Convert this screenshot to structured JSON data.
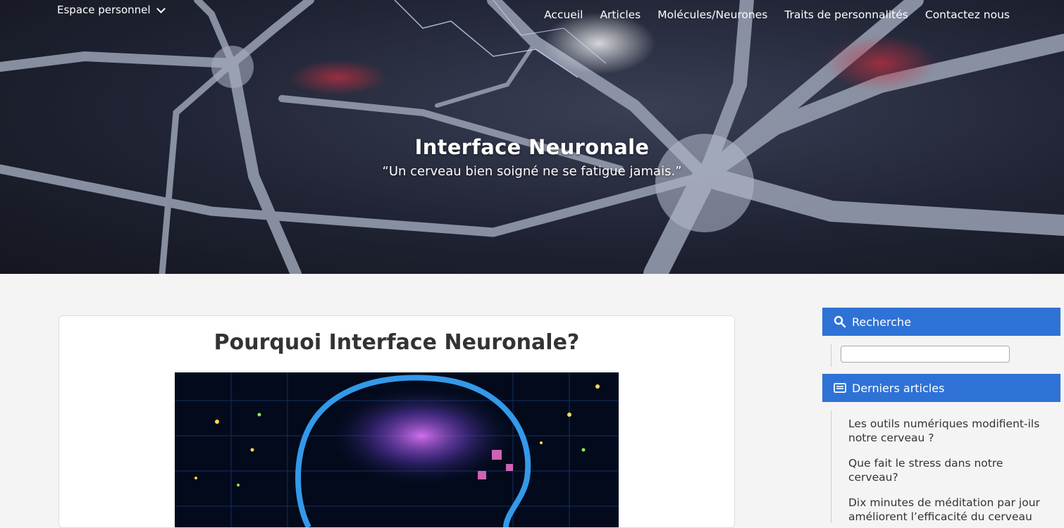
{
  "header": {
    "account_menu_label": "Espace personnel",
    "nav": [
      "Accueil",
      "Articles",
      "Molécules/Neurones",
      "Traits de personnalités",
      "Contactez nous"
    ],
    "site_title": "Interface Neuronale",
    "tagline": "“Un cerveau bien soigné ne se fatigue jamais.”"
  },
  "main": {
    "post_title": "Pourquoi Interface Neuronale?"
  },
  "sidebar": {
    "search_title": "Recherche",
    "search_placeholder": "",
    "recent_title": "Derniers articles",
    "recent_articles": [
      "Les outils numériques modifient-ils notre cerveau ?",
      "Que fait le stress dans notre cerveau?",
      "Dix minutes de méditation par jour améliorent l’efficacité du cerveau"
    ]
  },
  "colors": {
    "accent": "#2f72d6",
    "background": "#f4f4f4"
  },
  "icons": {
    "account_menu": "chevron-down-icon",
    "search": "search-icon",
    "recent": "list-icon"
  }
}
